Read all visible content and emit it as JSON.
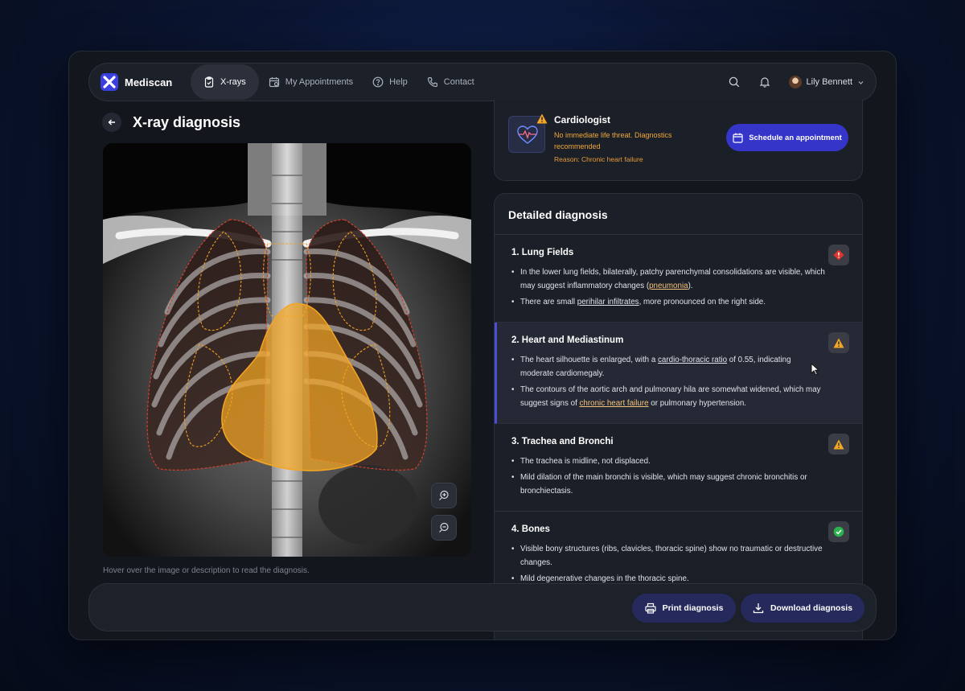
{
  "app": {
    "name": "Mediscan"
  },
  "nav": {
    "items": [
      {
        "label": "X-rays",
        "icon": "clipboard-icon",
        "active": true
      },
      {
        "label": "My Appointments",
        "icon": "calendar-icon",
        "active": false
      },
      {
        "label": "Help",
        "icon": "help-icon",
        "active": false
      },
      {
        "label": "Contact",
        "icon": "phone-icon",
        "active": false
      }
    ],
    "user_name": "Lily Bennett"
  },
  "page": {
    "title": "X-ray diagnosis",
    "hint": "Hover over the image or description to read the diagnosis."
  },
  "specialist": {
    "title": "Cardiologist",
    "description": "No immediate life threat. Diagnostics recommended",
    "reason": "Reason: Chronic heart failure",
    "schedule_label": "Schedule an appointment"
  },
  "diagnosis": {
    "header": "Detailed diagnosis",
    "sections": [
      {
        "title": "1. Lung Fields",
        "status": "danger",
        "b1a": "In the lower lung fields, bilaterally, patchy parenchymal consolidations are visible, which may suggest inflammatory changes (",
        "b1h": "pneumonia",
        "b1b": ").",
        "b2a": "There are small ",
        "b2h": "perihilar infiltrates",
        "b2b": ", more pronounced on the right side."
      },
      {
        "title": "2. Heart and Mediastinum",
        "status": "warning",
        "b1a": "The heart silhouette is enlarged, with a ",
        "b1h": "cardio-thoracic ratio",
        "b1b": " of 0.55, indicating moderate cardiomegaly.",
        "b2a": "The contours of the aortic arch and pulmonary hila are somewhat widened, which may suggest signs of ",
        "b2h": "chronic heart failure",
        "b2b": " or pulmonary hypertension."
      },
      {
        "title": "3. Trachea and Bronchi",
        "status": "warning",
        "b1": "The trachea is midline, not displaced.",
        "b2": "Mild dilation of the main bronchi is visible, which may suggest chronic bronchitis or bronchiectasis."
      },
      {
        "title": "4. Bones",
        "status": "ok",
        "b1": "Visible bony structures (ribs, clavicles, thoracic spine) show no traumatic or destructive changes.",
        "b2": "Mild degenerative changes in the thoracic spine."
      }
    ]
  },
  "actions": {
    "print_label": "Print diagnosis",
    "download_label": "Download diagnosis"
  },
  "colors": {
    "accent": "#3536c9",
    "warning": "#f0a93a",
    "danger": "#e0352f",
    "ok": "#2bb24c",
    "highlight": "#f5a623"
  }
}
